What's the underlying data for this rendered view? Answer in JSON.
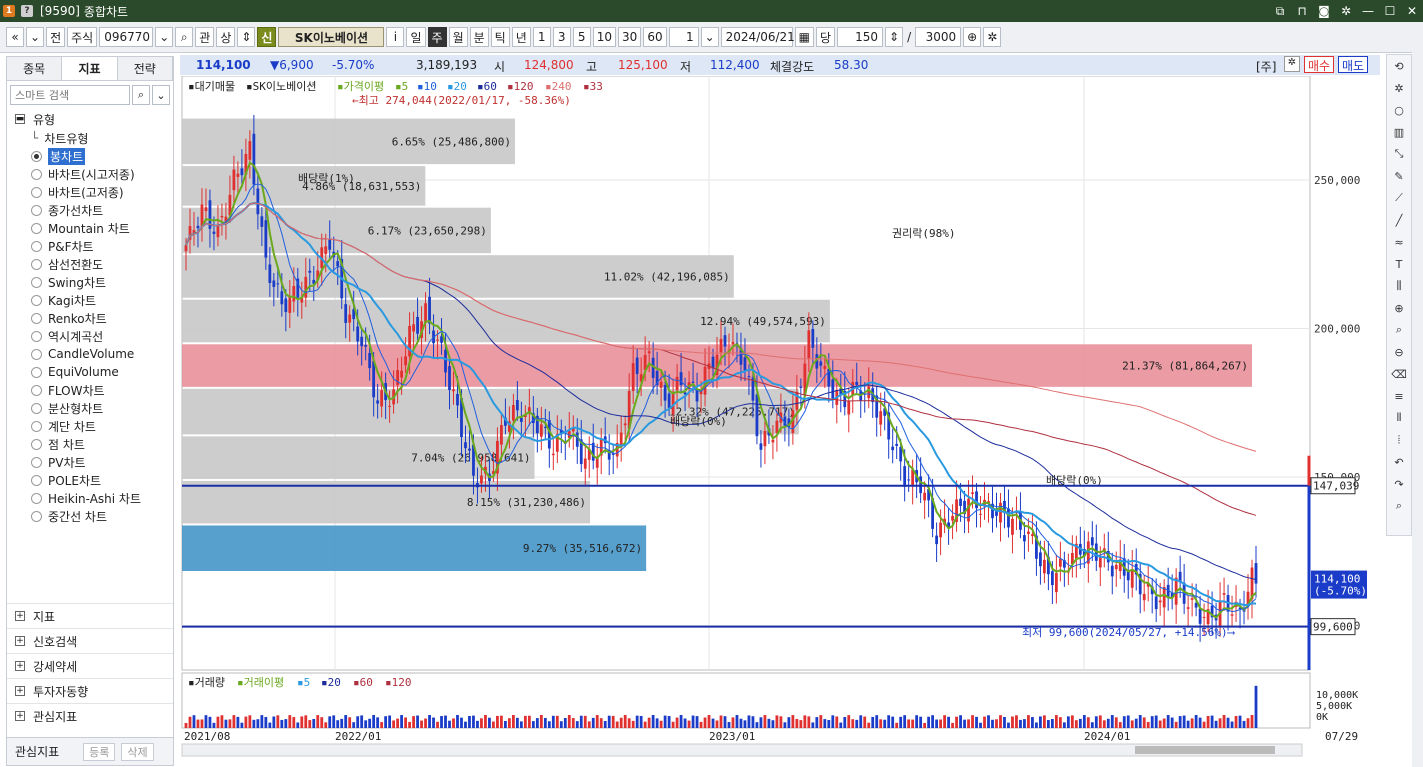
{
  "window": {
    "code": "[9590]",
    "title": "종합차트",
    "win_icons": [
      "link-icon",
      "pin-icon",
      "camera-icon",
      "gear-icon",
      "minimize-icon",
      "maximize-icon",
      "close-icon"
    ]
  },
  "toolbar": {
    "prev": "«",
    "down": "»",
    "jeon": "전",
    "market": "주식",
    "code": "096770",
    "search": "관",
    "sang": "상",
    "sin": "신",
    "name": "SK이노베이션",
    "info": "i",
    "periods": [
      "일",
      "주",
      "월",
      "분",
      "틱",
      "년"
    ],
    "active_period": "주",
    "counts": [
      "1",
      "3",
      "5",
      "10",
      "30",
      "60"
    ],
    "interval": "1",
    "date": "2024/06/21",
    "dang": "당",
    "bars": "150",
    "slash": "/",
    "max": "3000"
  },
  "left": {
    "tabs": [
      "종목",
      "지표",
      "전략"
    ],
    "active_tab": "지표",
    "search_placeholder": "스마트 검색",
    "type_header": "유형",
    "chart_type_header": "차트유형",
    "options": [
      "봉차트",
      "바차트(시고저종)",
      "바차트(고저종)",
      "종가선차트",
      "Mountain 차트",
      "P&F차트",
      "삼선전환도",
      "Swing차트",
      "Kagi차트",
      "Renko차트",
      "역시계곡선",
      "CandleVolume",
      "EquiVolume",
      "FLOW차트",
      "분산형차트",
      "계단 차트",
      "점 차트",
      "PV차트",
      "POLE차트",
      "Heikin-Ashi 차트",
      "중간선 차트"
    ],
    "selected": "봉차트",
    "sections": [
      "지표",
      "신호검색",
      "강세약세",
      "투자자동향",
      "관심지표"
    ],
    "footer": {
      "label": "관심지표",
      "register": "등록",
      "delete": "삭제"
    }
  },
  "price": {
    "current": "114,100",
    "change": "▼6,900",
    "pct": "-5.70%",
    "volume": "3,189,193",
    "open_lbl": "시",
    "open": "124,800",
    "high_lbl": "고",
    "high": "125,100",
    "low_lbl": "저",
    "low": "112,400",
    "strength_lbl": "체결강도",
    "strength": "58.30",
    "ju": "[주]",
    "buy": "매수",
    "sell": "매도"
  },
  "legend": {
    "items": [
      "대기매물",
      "SK이노베이션",
      "가격이평",
      "5",
      "10",
      "20",
      "60",
      "120",
      "240",
      "33"
    ]
  },
  "vol_legend": {
    "items": [
      "거래량",
      "거래이평",
      "5",
      "20",
      "60",
      "120"
    ]
  },
  "colors": {
    "up": "#e03030",
    "down": "#1a3cc8",
    "ma5": "#6aa81e",
    "ma10": "#2060e0",
    "ma20": "#2a9ae0",
    "ma60": "#1c2c9c",
    "ma120": "#b03040",
    "ma240": "#e07070",
    "profile": "#c8c8c8",
    "profile_hi": "#e8909a",
    "profile_lo": "#4596c8"
  },
  "chart_data": {
    "type": "candlestick",
    "period": "weekly",
    "x_labels": [
      "2021/08",
      "2022/01",
      "2023/01",
      "2024/01",
      "07/29"
    ],
    "y_ticks": [
      250000,
      200000,
      150000,
      100000
    ],
    "y_tick_labels": [
      "250,000",
      "200,000",
      "150,000",
      "100,000"
    ],
    "ylim": [
      85000,
      285000
    ],
    "annotations": {
      "high": "←최고 274,044(2022/01/17, -58.36%)",
      "low": "최저 99,600(2024/05/27, +14.56%)⟶",
      "div1": "배당락(1%)",
      "div2": "배당락(0%)",
      "div3": "배당락(0%)",
      "rights": "권리락(98%)"
    },
    "price_lines": [
      {
        "label": "147,039",
        "value": 147039
      },
      {
        "label": "99,600",
        "value": 99600
      }
    ],
    "current_label": "114,100",
    "current_pct": "(-5.70%)",
    "volume_profile": [
      {
        "low": 255000,
        "high": 271000,
        "label": "6.65% (25,486,800)",
        "pct": 6.65
      },
      {
        "low": 241000,
        "high": 255000,
        "label": "4.86% (18,631,553)",
        "pct": 4.86
      },
      {
        "low": 225000,
        "high": 241000,
        "label": "6.17% (23,650,298)",
        "pct": 6.17
      },
      {
        "low": 210000,
        "high": 225000,
        "label": "11.02% (42,196,085)",
        "pct": 11.02
      },
      {
        "low": 195000,
        "high": 210000,
        "label": "12.94% (49,574,593)",
        "pct": 12.94
      },
      {
        "low": 180000,
        "high": 195000,
        "label": "21.37% (81,864,267)",
        "pct": 21.37,
        "hi": true
      },
      {
        "low": 164000,
        "high": 180000,
        "label": "12.32% (47,225,717)",
        "pct": 12.32
      },
      {
        "low": 149000,
        "high": 164000,
        "label": "7.04% (26,958,641)",
        "pct": 7.04
      },
      {
        "low": 134000,
        "high": 149000,
        "label": "8.15% (31,230,486)",
        "pct": 8.15
      },
      {
        "low": 118000,
        "high": 134000,
        "label": "9.27% (35,516,672)",
        "pct": 9.27,
        "lo": true
      }
    ],
    "volume_ticks": [
      "10,000K",
      "5,000K",
      "0K"
    ]
  }
}
